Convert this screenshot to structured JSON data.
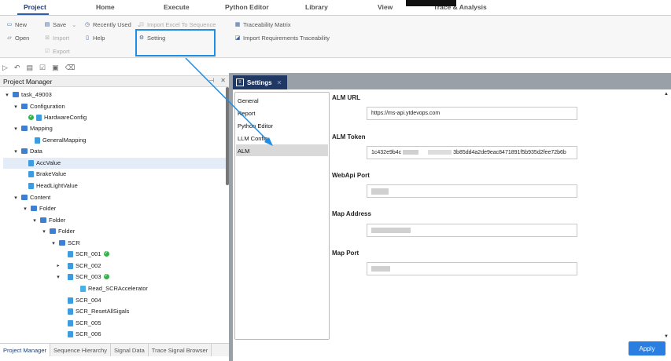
{
  "menubar": {
    "tabs": [
      "Project",
      "Home",
      "Execute",
      "Python Editor",
      "Library",
      "View",
      "Trace & Analysis"
    ]
  },
  "ribbon": {
    "new": "New",
    "open": "Open",
    "save": "Save",
    "import": "Import",
    "export": "Export",
    "recently_used": "Recently Used",
    "help": "Help",
    "import_excel": "Import Excel To Sequence",
    "setting": "Setting",
    "traceability_matrix": "Traceability Matrix",
    "import_requirements": "Import Requirements Traceability"
  },
  "project_manager": {
    "title": "Project Manager",
    "tree": {
      "task": "task_49003",
      "configuration": "Configuration",
      "hardware_config": "HardwareConfig",
      "mapping": "Mapping",
      "general_mapping": "GeneralMapping",
      "data": "Data",
      "acc_value": "AccValue",
      "brake_value": "BrakeValue",
      "headlight_value": "HeadLightValue",
      "content": "Content",
      "folder1": "Folder",
      "folder2": "Folder",
      "folder3": "Folder",
      "scr": "SCR",
      "scr_001": "SCR_001",
      "scr_002": "SCR_002",
      "scr_003": "SCR_003",
      "read_scr": "Read_SCRAccelerator",
      "scr_004": "SCR_004",
      "scr_reset": "SCR_ResetAllSigals",
      "scr_005": "SCR_005",
      "scr_006": "SCR_006"
    },
    "bottom_tabs": [
      "Project Manager",
      "Sequence Hierarchy",
      "Signal Data",
      "Trace Signal Browser"
    ]
  },
  "settings": {
    "tab_title": "Settings",
    "nav": [
      "General",
      "Report",
      "Python Editor",
      "LLM Config",
      "ALM"
    ],
    "alm_url_label": "ALM URL",
    "alm_url_value": "https://ms-api.ytdevops.com",
    "alm_token_label": "ALM Token",
    "alm_token_prefix": "1c432e9b4c",
    "alm_token_suffix": "3b85dd4a2de9eac8471891f5b935d2fee72b6b",
    "webapi_port_label": "WebApi Port",
    "map_address_label": "Map Address",
    "map_port_label": "Map Port",
    "apply_label": "Apply"
  },
  "colors": {
    "accent": "#2a7de1",
    "settings_tab": "#1f3864",
    "highlight": "#1f8de3",
    "panel_bg": "#9aa0a8"
  }
}
